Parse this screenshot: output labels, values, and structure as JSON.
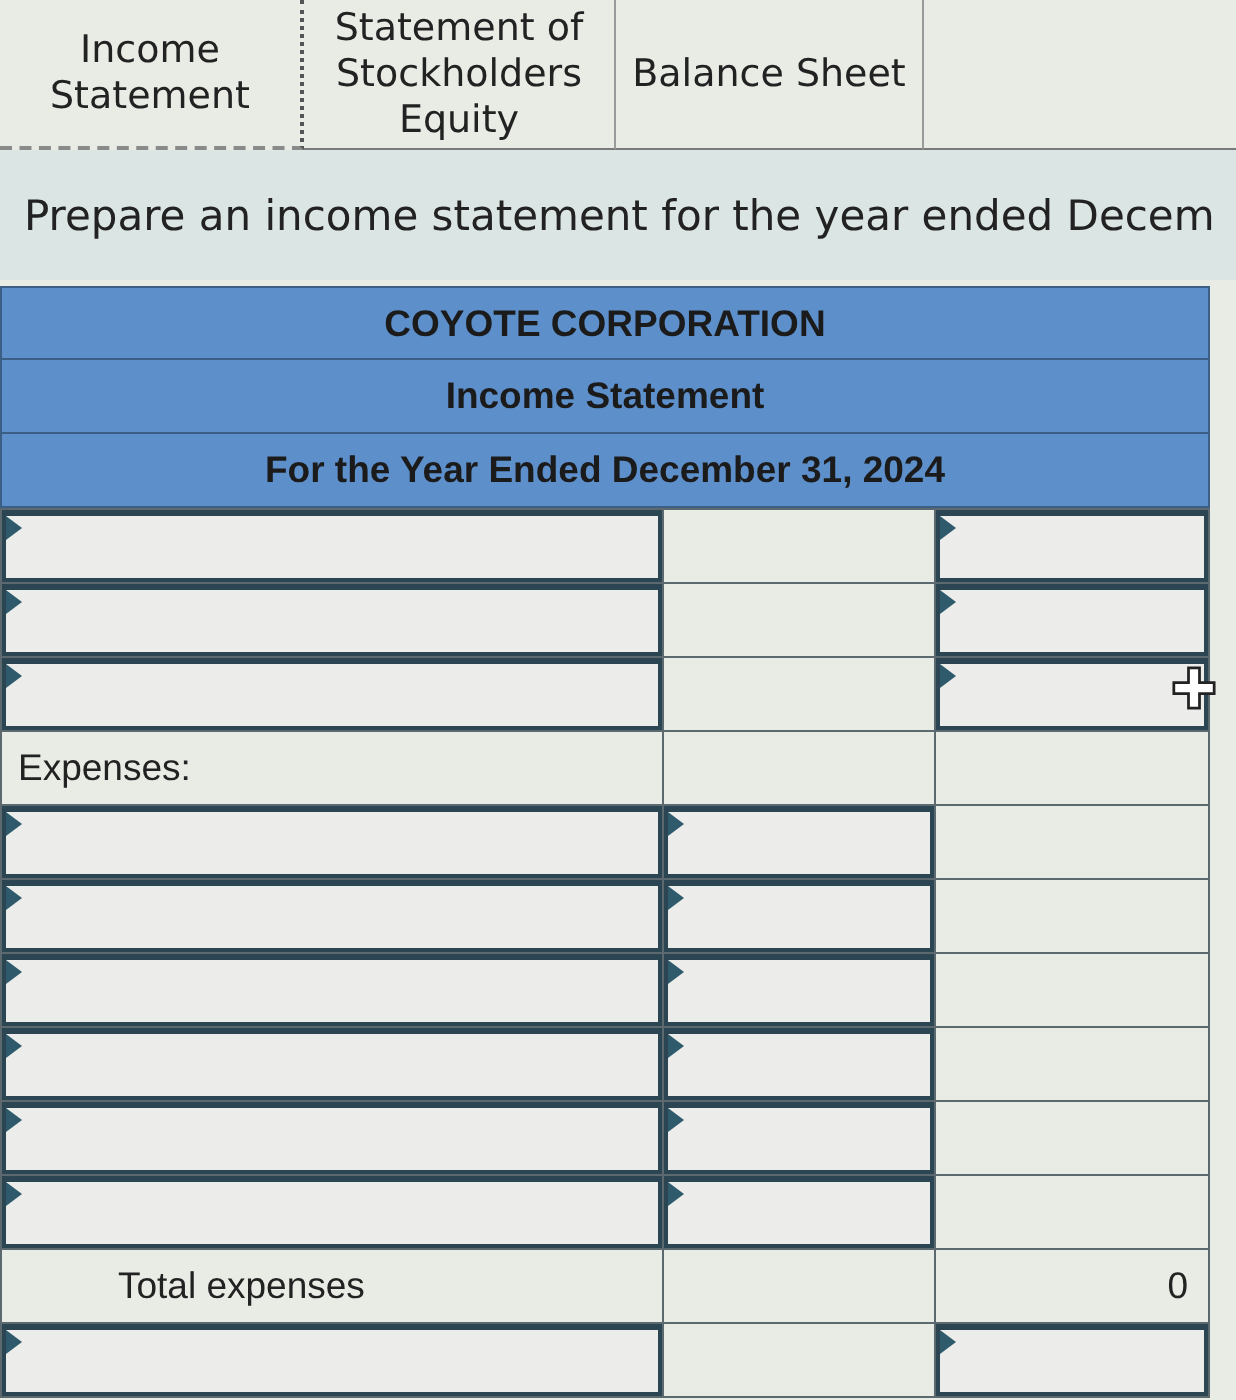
{
  "tabs": [
    {
      "label": "Income Statement",
      "selected": true
    },
    {
      "label": "Statement of Stockholders Equity",
      "selected": false
    },
    {
      "label": "Balance Sheet",
      "selected": false
    }
  ],
  "instruction": "Prepare an income statement for the year ended Decem",
  "statement": {
    "title_lines": [
      "COYOTE CORPORATION",
      "Income Statement",
      "For the Year Ended December 31, 2024"
    ],
    "rows": [
      {
        "cells": [
          {
            "kind": "input"
          },
          {
            "kind": "blank"
          },
          {
            "kind": "input"
          }
        ]
      },
      {
        "cells": [
          {
            "kind": "input"
          },
          {
            "kind": "blank"
          },
          {
            "kind": "input"
          }
        ]
      },
      {
        "cells": [
          {
            "kind": "input"
          },
          {
            "kind": "blank"
          },
          {
            "kind": "input"
          }
        ]
      },
      {
        "cells": [
          {
            "kind": "heading",
            "text": "Expenses:"
          },
          {
            "kind": "blank"
          },
          {
            "kind": "blank"
          }
        ]
      },
      {
        "cells": [
          {
            "kind": "input"
          },
          {
            "kind": "input"
          },
          {
            "kind": "blank"
          }
        ]
      },
      {
        "cells": [
          {
            "kind": "input"
          },
          {
            "kind": "input"
          },
          {
            "kind": "blank"
          }
        ]
      },
      {
        "cells": [
          {
            "kind": "input"
          },
          {
            "kind": "input"
          },
          {
            "kind": "blank"
          }
        ]
      },
      {
        "cells": [
          {
            "kind": "input"
          },
          {
            "kind": "input"
          },
          {
            "kind": "blank"
          }
        ]
      },
      {
        "cells": [
          {
            "kind": "input"
          },
          {
            "kind": "input"
          },
          {
            "kind": "blank"
          }
        ]
      },
      {
        "cells": [
          {
            "kind": "input"
          },
          {
            "kind": "input"
          },
          {
            "kind": "blank"
          }
        ]
      },
      {
        "cells": [
          {
            "kind": "total",
            "text": "Total expenses"
          },
          {
            "kind": "blank"
          },
          {
            "kind": "amount",
            "text": "0"
          }
        ]
      },
      {
        "cells": [
          {
            "kind": "input"
          },
          {
            "kind": "blank"
          },
          {
            "kind": "input"
          }
        ]
      }
    ]
  }
}
